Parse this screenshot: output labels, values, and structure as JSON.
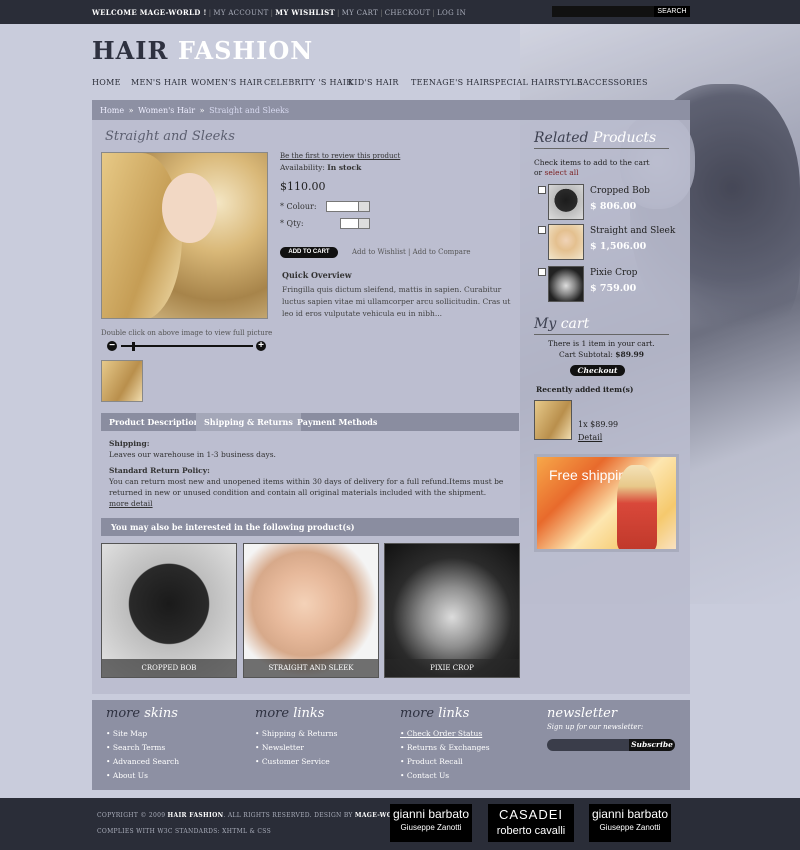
{
  "topbar": {
    "links": [
      "WELCOME MAGE-WORLD !",
      "MY ACCOUNT",
      "MY WISHLIST",
      "MY CART",
      "CHECKOUT",
      "LOG IN"
    ],
    "search_button": "SEARCH"
  },
  "logo": {
    "part1": "HAIR",
    "part2": "FASHION"
  },
  "nav": [
    "HOME",
    "MEN'S HAIR",
    "WOMEN'S HAIR",
    "CELEBRITY 'S HAIR",
    "KID'S HAIR",
    "TEENAGE'S HAIR",
    "SPECIAL HAIRSTYLE",
    "SACCESSORIES"
  ],
  "breadcrumb": {
    "home": "Home",
    "sep": "»",
    "category": "Women's Hair",
    "current": "Straight and Sleeks"
  },
  "product": {
    "title": "Straight and Sleeks",
    "review_link": "Be the first to review this product",
    "availability_label": "Availability:",
    "availability_value": "In stock",
    "price": "$110.00",
    "colour_label": "* Colour:",
    "qty_label": "* Qty:",
    "add_to_cart": "ADD TO CART",
    "wishlist": "Add to Wishlist",
    "compare": "Add to Compare",
    "overview_title": "Quick Overview",
    "overview_text": "Fringilla quis dictum sleifend, mattis in sapien. Curabitur luctus sapien vitae mi ullamcorper arcu sollicitudin. Cras ut leo id eros vulputate vehicula eu in nibh...",
    "zoom_hint": "Double click on above image to view full picture"
  },
  "tabs": [
    "Product Description",
    "Shipping & Returns",
    "Payment Methods"
  ],
  "shipping": {
    "shipping_title": "Shipping:",
    "shipping_text": "Leaves our warehouse in 1-3 business days.",
    "return_title": "Standard Return Policy:",
    "return_text": "You can return most new and unopened items within 30 days of delivery for a full refund.Items must be returned in new or unused condition and contain all original materials included with the shipment.",
    "more_detail": "more detail"
  },
  "interested": {
    "title": "You may also be interested in the following product(s)",
    "items": [
      "CROPPED BOB",
      "STRAIGHT AND SLEEK",
      "PIXIE CROP"
    ]
  },
  "related": {
    "title_a": "Related",
    "title_b": "Products",
    "note": "Check items to add to the cart",
    "note_or": "or",
    "select_all": "select all",
    "items": [
      {
        "name": "Cropped Bob",
        "price": "$ 806.00"
      },
      {
        "name": "Straight and Sleek",
        "price": "$ 1,506.00"
      },
      {
        "name": "Pixie Crop",
        "price": "$ 759.00"
      }
    ]
  },
  "cart": {
    "title_a": "My",
    "title_b": "cart",
    "count_text": "There is 1 item in your cart.",
    "subtotal_label": "Cart Subtotal:",
    "subtotal_value": "$89.99",
    "checkout": "Checkout",
    "recent_title": "Recently added item(s)",
    "recent_qty": "1x $89.99",
    "recent_detail": "Detail"
  },
  "banner": {
    "text": "Free shipping"
  },
  "footer": {
    "skins": {
      "a": "more",
      "b": "skins",
      "items": [
        "Site Map",
        "Search Terms",
        "Advanced Search",
        "About Us"
      ]
    },
    "links1": {
      "a": "more",
      "b": "links",
      "items": [
        "Shipping & Returns",
        "Newsletter",
        "Customer Service"
      ]
    },
    "links2": {
      "a": "more",
      "b": "links",
      "items": [
        "Check Order Status",
        "Returns & Exchanges",
        "Product Recall",
        "Contact Us"
      ]
    },
    "newsletter": {
      "title": "newsletter",
      "subtitle": "Sign up for our newsletter:",
      "button": "Subscribe"
    }
  },
  "bottom": {
    "copyright_pre": "COPYRIGHT © 2009",
    "copyright_brand": "HAIR FASHION",
    "copyright_mid": ". ALL RIGHTS RESERVED. DESIGN BY",
    "copyright_design": "MAGE-WORLD",
    "complies": "COMPLIES WITH W3C STANDARDS: XHTML & CSS",
    "brands": [
      {
        "l1": "gianni barbato",
        "l2": "Giuseppe Zanotti"
      },
      {
        "l1": "CASADEI",
        "l2": "roberto cavalli"
      },
      {
        "l1": "gianni barbato",
        "l2": "Giuseppe Zanotti"
      }
    ]
  }
}
